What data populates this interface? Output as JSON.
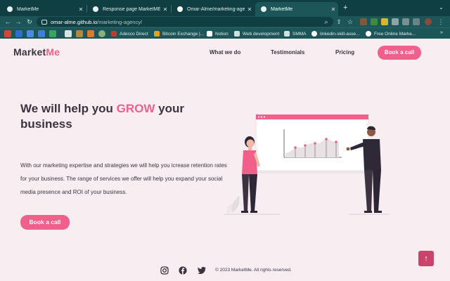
{
  "browser": {
    "tabs": [
      {
        "title": "MarketMe",
        "active": false
      },
      {
        "title": "Response page MarketME",
        "active": false
      },
      {
        "title": "Omar-Alme/marketing-agency",
        "active": false
      },
      {
        "title": "MarketMe",
        "active": true
      }
    ],
    "new_tab_label": "+",
    "url_host": "omar-alme.github.io",
    "url_path": "/marketing-agency/",
    "bookmarks": [
      "Adecco Direct",
      "Bitcoin Exchange |...",
      "Notion",
      "Web development",
      "SMMA",
      "linkedin-skill-asse...",
      "Free Online Marke..."
    ],
    "bookmarks_more": "»"
  },
  "site": {
    "logo_main": "Market",
    "logo_accent": "Me",
    "nav": [
      "What we do",
      "Testimonials",
      "Pricing"
    ],
    "nav_cta": "Book a call",
    "hero": {
      "title_before": "We will help you ",
      "title_highlight": "GROW",
      "title_after": " your business",
      "text": "With our marketing expertise and strategies we will help you icrease retention rates for your business. The range of services we offer will help you expand your social media presence and ROI of your business.",
      "cta": "Book a call"
    },
    "footer": {
      "icons": [
        "instagram-icon",
        "facebook-icon",
        "twitter-icon"
      ],
      "copyright": "© 2023 MarketMe. All rights reserved."
    },
    "scroll_top_glyph": "↑"
  },
  "colors": {
    "accent": "#f0608a",
    "page_bg": "#f8eef2",
    "text": "#3b3340",
    "chrome_dark": "#0f3f42",
    "chrome": "#1c5659"
  }
}
